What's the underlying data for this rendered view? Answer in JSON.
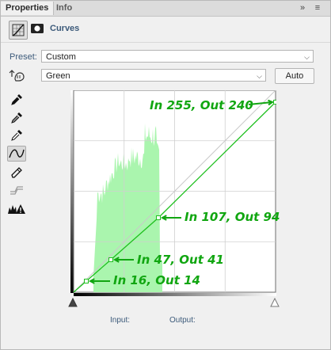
{
  "tabs": [
    {
      "label": "Properties",
      "active": true
    },
    {
      "label": "Info",
      "active": false
    }
  ],
  "tabbar_buttons": {
    "collapse": "»",
    "menu": "≡"
  },
  "header": {
    "title": "Curves"
  },
  "preset": {
    "label": "Preset:",
    "value": "Custom"
  },
  "channel": {
    "value": "Green"
  },
  "auto_button": {
    "label": "Auto"
  },
  "graph": {
    "curve_color": "#1fc01f",
    "histogram_color": "#aaf5ae",
    "annotation_color": "#11a611",
    "control_points": [
      {
        "in": 0,
        "out": 0
      },
      {
        "in": 16,
        "out": 14
      },
      {
        "in": 47,
        "out": 41
      },
      {
        "in": 107,
        "out": 94
      },
      {
        "in": 255,
        "out": 240
      }
    ],
    "annotations": [
      {
        "text": "In 255, Out 240",
        "in": 255,
        "out": 240
      },
      {
        "text": "In 107, Out 94",
        "in": 107,
        "out": 94
      },
      {
        "text": "In 47, Out 41",
        "in": 47,
        "out": 41
      },
      {
        "text": "In 16, Out 14",
        "in": 16,
        "out": 14
      }
    ]
  },
  "io": {
    "input_label": "Input:",
    "output_label": "Output:"
  }
}
